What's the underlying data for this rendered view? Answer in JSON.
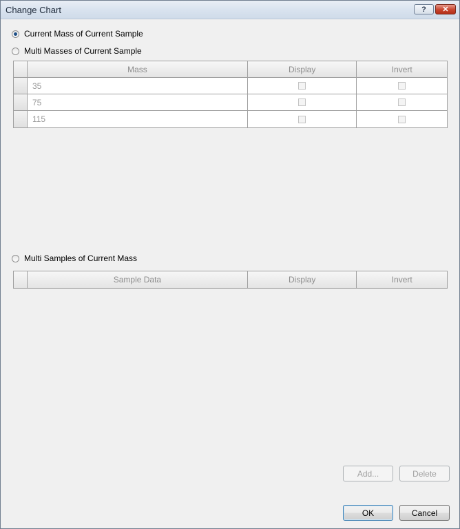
{
  "window": {
    "title": "Change Chart"
  },
  "titlebar": {
    "help_glyph": "?",
    "close_glyph": "✕"
  },
  "options": {
    "current_mass": "Current Mass of Current Sample",
    "multi_masses": "Multi Masses of Current Sample",
    "multi_samples": "Multi Samples of Current Mass",
    "selected": "current_mass"
  },
  "mass_grid": {
    "headers": {
      "mass": "Mass",
      "display": "Display",
      "invert": "Invert"
    },
    "rows": [
      {
        "mass": "35",
        "display": false,
        "invert": false
      },
      {
        "mass": "75",
        "display": false,
        "invert": false
      },
      {
        "mass": "115",
        "display": false,
        "invert": false
      }
    ]
  },
  "sample_grid": {
    "headers": {
      "sample": "Sample Data",
      "display": "Display",
      "invert": "Invert"
    }
  },
  "buttons": {
    "add": "Add...",
    "delete": "Delete",
    "ok": "OK",
    "cancel": "Cancel"
  }
}
